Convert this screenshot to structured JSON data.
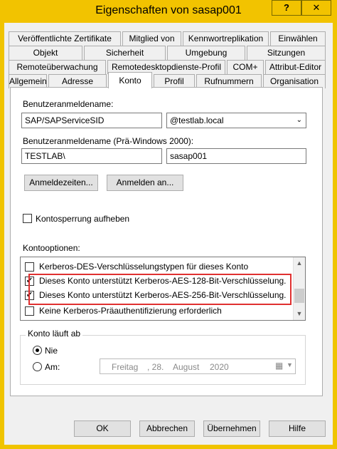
{
  "window": {
    "title": "Eigenschaften von sasap001",
    "help_button": "?",
    "close_button": "✕"
  },
  "tabs": {
    "row1": [
      "Veröffentlichte Zertifikate",
      "Mitglied von",
      "Kennwortreplikation",
      "Einwählen"
    ],
    "row2": [
      "Objekt",
      "Sicherheit",
      "Umgebung",
      "Sitzungen"
    ],
    "row3": [
      "Remoteüberwachung",
      "Remotedesktopdienste-Profil",
      "COM+",
      "Attribut-Editor"
    ],
    "row4": [
      "Allgemein",
      "Adresse",
      "Konto",
      "Profil",
      "Rufnummern",
      "Organisation"
    ],
    "active": "Konto"
  },
  "account": {
    "logon_name_label": "Benutzeranmeldename:",
    "logon_name_value": "SAP/SAPServiceSID",
    "domain_value": "@testlab.local",
    "pre2000_label": "Benutzeranmeldename (Prä-Windows 2000):",
    "pre2000_domain": "TESTLAB\\",
    "pre2000_user": "sasap001",
    "logon_hours_button": "Anmeldezeiten...",
    "logon_to_button": "Anmelden an...",
    "unlock_label": "Kontosperrung aufheben",
    "unlock_checked": false
  },
  "options": {
    "label": "Kontooptionen:",
    "items": [
      {
        "text": "Kerberos-DES-Verschlüsselungstypen für dieses Konto",
        "checked": false
      },
      {
        "text": "Dieses Konto unterstützt Kerberos-AES-128-Bit-Verschlüsselung.",
        "checked": true
      },
      {
        "text": "Dieses Konto unterstützt Kerberos-AES-256-Bit-Verschlüsselung.",
        "checked": true
      },
      {
        "text": "Keine Kerberos-Präauthentifizierung erforderlich",
        "checked": false
      }
    ]
  },
  "expiry": {
    "group_label": "Konto läuft ab",
    "never_label": "Nie",
    "at_label": "Am:",
    "selected": "Nie",
    "date": {
      "weekday": "Freitag",
      "day": ", 28.",
      "month": "August",
      "year": "2020"
    }
  },
  "footer": {
    "ok": "OK",
    "cancel": "Abbrechen",
    "apply": "Übernehmen",
    "help": "Hilfe"
  },
  "colors": {
    "title_bar": "#f2c300",
    "highlight": "#e03030"
  }
}
